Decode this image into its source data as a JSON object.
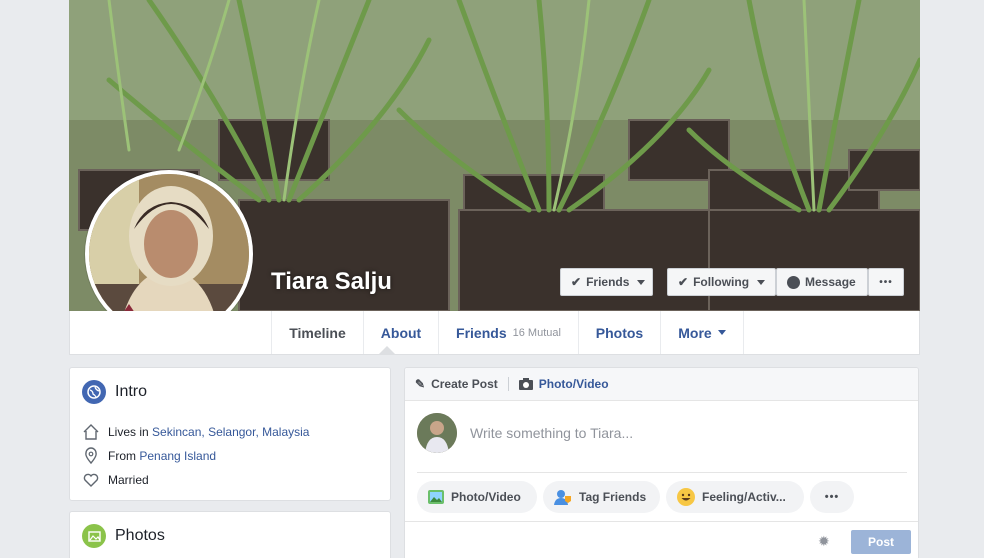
{
  "profile": {
    "name": "Tiara Salju"
  },
  "actions": {
    "friends_label": "Friends",
    "following_label": "Following",
    "message_label": "Message",
    "more_glyph": "•••"
  },
  "nav": {
    "timeline": "Timeline",
    "about": "About",
    "friends": "Friends",
    "friends_mutual": "16 Mutual",
    "photos": "Photos",
    "more": "More"
  },
  "intro": {
    "title": "Intro",
    "lives_prefix": "Lives in ",
    "lives_place": "Sekincan, Selangor, Malaysia",
    "from_prefix": "From ",
    "from_place": "Penang Island",
    "relationship": "Married"
  },
  "photos_card": {
    "title": "Photos"
  },
  "composer": {
    "create_post": "Create Post",
    "photo_video_tab": "Photo/Video",
    "placeholder": "Write something to Tiara...",
    "chip_photo_video": "Photo/Video",
    "chip_tag_friends": "Tag Friends",
    "chip_feeling": "Feeling/Activ...",
    "chip_more": "•••",
    "post_button": "Post"
  },
  "colors": {
    "link": "#365899",
    "background": "#e9ebee",
    "post_button_disabled": "#9cb4d8"
  }
}
